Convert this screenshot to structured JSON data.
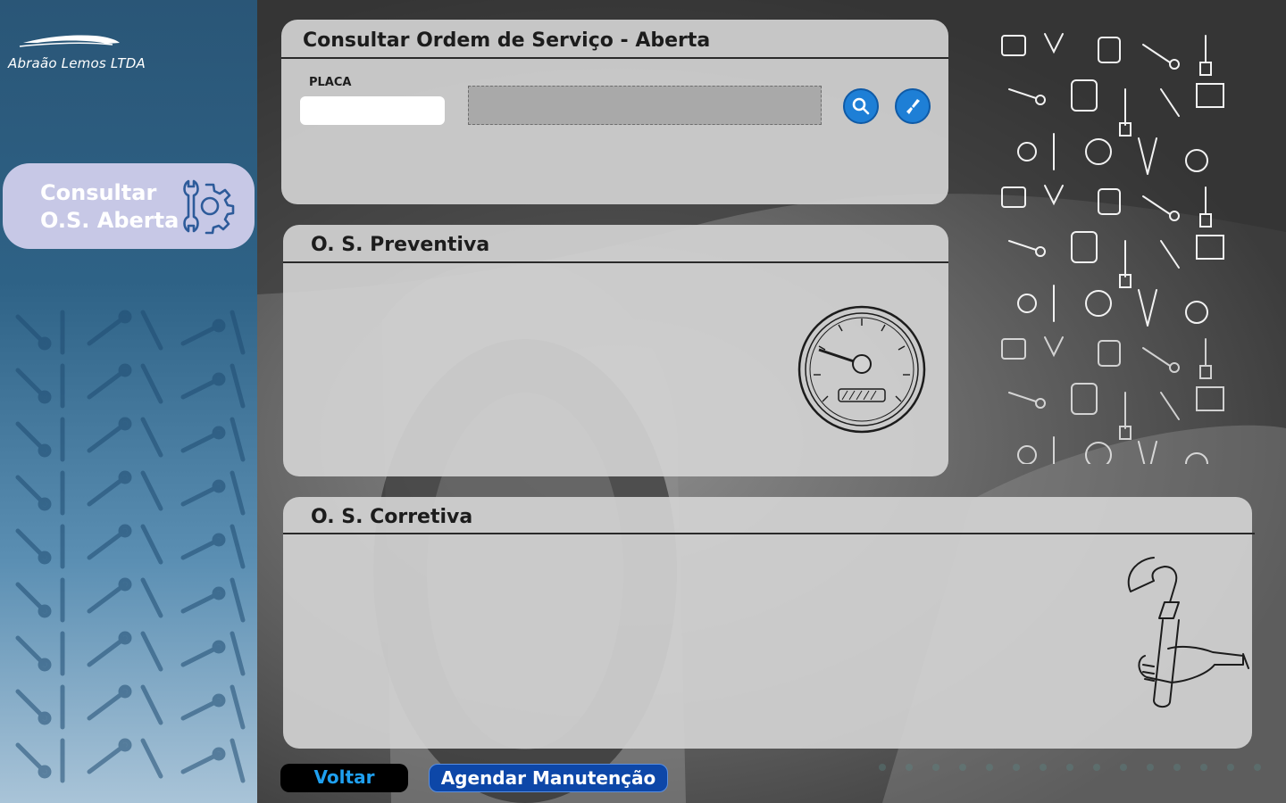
{
  "brand": {
    "name": "Abraão Lemos LTDA",
    "logo_icon": "car-silhouette-icon"
  },
  "sidebar": {
    "items": [
      {
        "label": "Consultar\nO.S. Aberta",
        "icon": "gear-wrench-icon",
        "active": true
      }
    ]
  },
  "consult": {
    "title": "Consultar Ordem de Serviço - Aberta",
    "placa_label": "PLACA",
    "placa_value": "",
    "result_value": "",
    "search_icon": "search-icon",
    "clear_icon": "brush-icon"
  },
  "preventiva": {
    "title": "O. S. Preventiva",
    "illustration": "speedometer-icon"
  },
  "corretiva": {
    "title": "O. S. Corretiva",
    "illustration": "pipe-wrench-hand-icon"
  },
  "actions": {
    "back_label": "Voltar",
    "schedule_label": "Agendar Manutenção"
  },
  "colors": {
    "accent_blue": "#1e7fd6",
    "schedule_button": "#0d47a8",
    "back_text": "#1fa0f0",
    "sidebar_active": "#c7c8e6"
  }
}
